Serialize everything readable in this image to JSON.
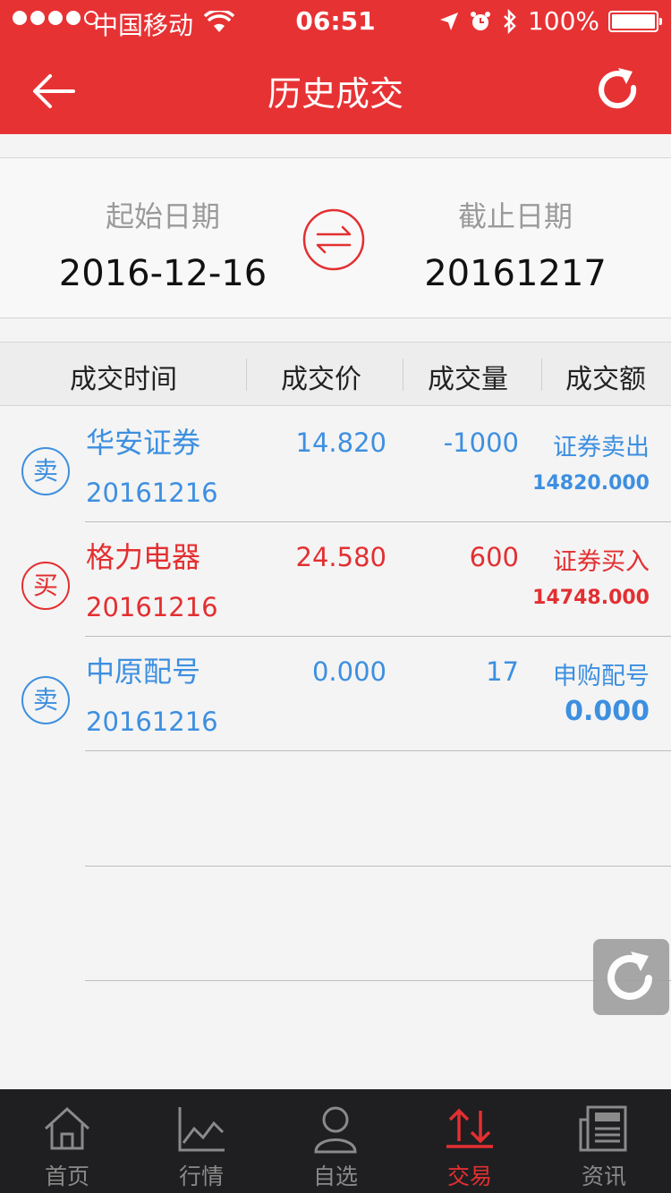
{
  "status_bar": {
    "carrier": "中国移动",
    "time": "06:51",
    "battery": "100%"
  },
  "header": {
    "title": "历史成交"
  },
  "date_range": {
    "start_label": "起始日期",
    "start_value": "2016-12-16",
    "end_label": "截止日期",
    "end_value": "20161217"
  },
  "table": {
    "headers": [
      "成交时间",
      "成交价",
      "成交量",
      "成交额"
    ],
    "rows": [
      {
        "badge": "卖",
        "name": "华安证券",
        "date": "20161216",
        "price": "14.820",
        "qty": "-1000",
        "type": "证券卖出",
        "amount": "14820.000"
      },
      {
        "badge": "买",
        "name": "格力电器",
        "date": "20161216",
        "price": "24.580",
        "qty": "600",
        "type": "证券买入",
        "amount": "14748.000"
      },
      {
        "badge": "卖",
        "name": "中原配号",
        "date": "20161216",
        "price": "0.000",
        "qty": "17",
        "type": "申购配号",
        "amount": "0.000"
      }
    ]
  },
  "tabbar": {
    "items": [
      {
        "label": "首页"
      },
      {
        "label": "行情"
      },
      {
        "label": "自选"
      },
      {
        "label": "交易"
      },
      {
        "label": "资讯"
      }
    ],
    "active_index": 3
  },
  "colors": {
    "brand_red": "#e73234",
    "sell_blue": "#3d8fe0",
    "buy_red": "#e32f31"
  }
}
